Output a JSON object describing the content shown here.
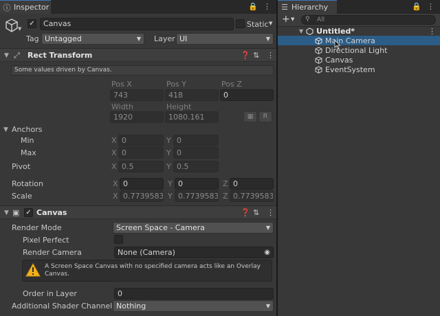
{
  "inspector": {
    "tab_title": "Inspector",
    "object_name": "Canvas",
    "active_checked": true,
    "static_label": "Static",
    "static_checked": false,
    "tag_label": "Tag",
    "tag_value": "Untagged",
    "layer_label": "Layer",
    "layer_value": "UI",
    "rect_transform": {
      "title": "Rect Transform",
      "driven_note": "Some values driven by Canvas.",
      "pos_x_label": "Pos X",
      "pos_y_label": "Pos Y",
      "pos_z_label": "Pos Z",
      "pos_x": "743",
      "pos_y": "418",
      "pos_z": "0",
      "width_label": "Width",
      "height_label": "Height",
      "width": "1920",
      "height": "1080.161",
      "raw_button": "R",
      "anchors_label": "Anchors",
      "min_label": "Min",
      "max_label": "Max",
      "x_label": "X",
      "y_label": "Y",
      "z_label": "Z",
      "min_x": "0",
      "min_y": "0",
      "max_x": "0",
      "max_y": "0",
      "pivot_label": "Pivot",
      "pivot_x": "0.5",
      "pivot_y": "0.5",
      "rotation_label": "Rotation",
      "rot_x": "0",
      "rot_y": "0",
      "rot_z": "0",
      "scale_label": "Scale",
      "scale_x": "0.7739583",
      "scale_y": "0.7739583",
      "scale_z": "0.7739583"
    },
    "canvas": {
      "title": "Canvas",
      "enabled": true,
      "render_mode_label": "Render Mode",
      "render_mode_value": "Screen Space - Camera",
      "pixel_perfect_label": "Pixel Perfect",
      "render_camera_label": "Render Camera",
      "render_camera_value": "None (Camera)",
      "warning_text": "A Screen Space Canvas with no specified camera acts like an Overlay Canvas.",
      "order_in_layer_label": "Order in Layer",
      "order_in_layer_value": "0",
      "shader_channels_label": "Additional Shader Channels",
      "shader_channels_value": "Nothing"
    }
  },
  "hierarchy": {
    "tab_title": "Hierarchy",
    "search_placeholder": "All",
    "scene_name": "Untitled*",
    "items": [
      {
        "label": "Main Camera",
        "selected": true
      },
      {
        "label": "Directional Light",
        "selected": false
      },
      {
        "label": "Canvas",
        "selected": false
      },
      {
        "label": "EventSystem",
        "selected": false
      }
    ]
  },
  "colors": {
    "panel_bg": "#383838",
    "selection": "#2c5d87",
    "accent": "#3a79bb",
    "warning": "#f2b01e"
  }
}
